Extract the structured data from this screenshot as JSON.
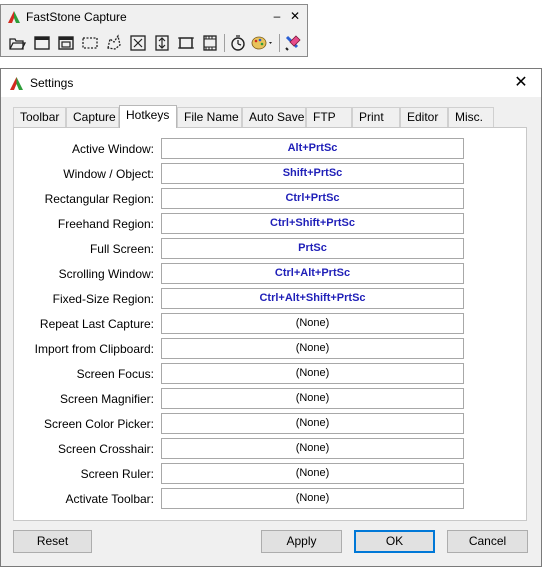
{
  "toolbar": {
    "title": "FastStone Capture",
    "minimize": "–",
    "close": "✕",
    "buttons": [
      {
        "name": "open-file-icon"
      },
      {
        "name": "capture-window-icon"
      },
      {
        "name": "capture-object-icon"
      },
      {
        "name": "capture-rectangle-icon"
      },
      {
        "name": "capture-freehand-icon"
      },
      {
        "name": "capture-fullscreen-icon"
      },
      {
        "name": "capture-scrolling-icon"
      },
      {
        "name": "capture-fixed-region-icon"
      },
      {
        "name": "screen-recorder-icon"
      },
      {
        "name": "delay-timer-icon"
      },
      {
        "name": "output-palette-icon"
      },
      {
        "name": "settings-tools-icon"
      }
    ]
  },
  "window": {
    "title": "Settings",
    "close": "✕"
  },
  "tabs": [
    "Toolbar",
    "Capture",
    "Hotkeys",
    "File Name",
    "Auto Save",
    "FTP",
    "Print",
    "Editor",
    "Misc."
  ],
  "active_tab": "Hotkeys",
  "hotkeys": [
    {
      "label": "Active Window:",
      "value": "Alt+PrtSc",
      "set": true
    },
    {
      "label": "Window / Object:",
      "value": "Shift+PrtSc",
      "set": true
    },
    {
      "label": "Rectangular Region:",
      "value": "Ctrl+PrtSc",
      "set": true
    },
    {
      "label": "Freehand Region:",
      "value": "Ctrl+Shift+PrtSc",
      "set": true
    },
    {
      "label": "Full Screen:",
      "value": "PrtSc",
      "set": true
    },
    {
      "label": "Scrolling Window:",
      "value": "Ctrl+Alt+PrtSc",
      "set": true
    },
    {
      "label": "Fixed-Size Region:",
      "value": "Ctrl+Alt+Shift+PrtSc",
      "set": true
    },
    {
      "label": "Repeat Last Capture:",
      "value": "(None)",
      "set": false
    },
    {
      "label": "Import from Clipboard:",
      "value": "(None)",
      "set": false
    },
    {
      "label": "Screen Focus:",
      "value": "(None)",
      "set": false
    },
    {
      "label": "Screen Magnifier:",
      "value": "(None)",
      "set": false
    },
    {
      "label": "Screen Color Picker:",
      "value": "(None)",
      "set": false
    },
    {
      "label": "Screen Crosshair:",
      "value": "(None)",
      "set": false
    },
    {
      "label": "Screen Ruler:",
      "value": "(None)",
      "set": false
    },
    {
      "label": "Activate Toolbar:",
      "value": "(None)",
      "set": false
    }
  ],
  "buttons": {
    "reset": "Reset",
    "apply": "Apply",
    "ok": "OK",
    "cancel": "Cancel"
  },
  "colors": {
    "hotkey_text": "#1f1fb8",
    "focus_border": "#0078d7"
  }
}
